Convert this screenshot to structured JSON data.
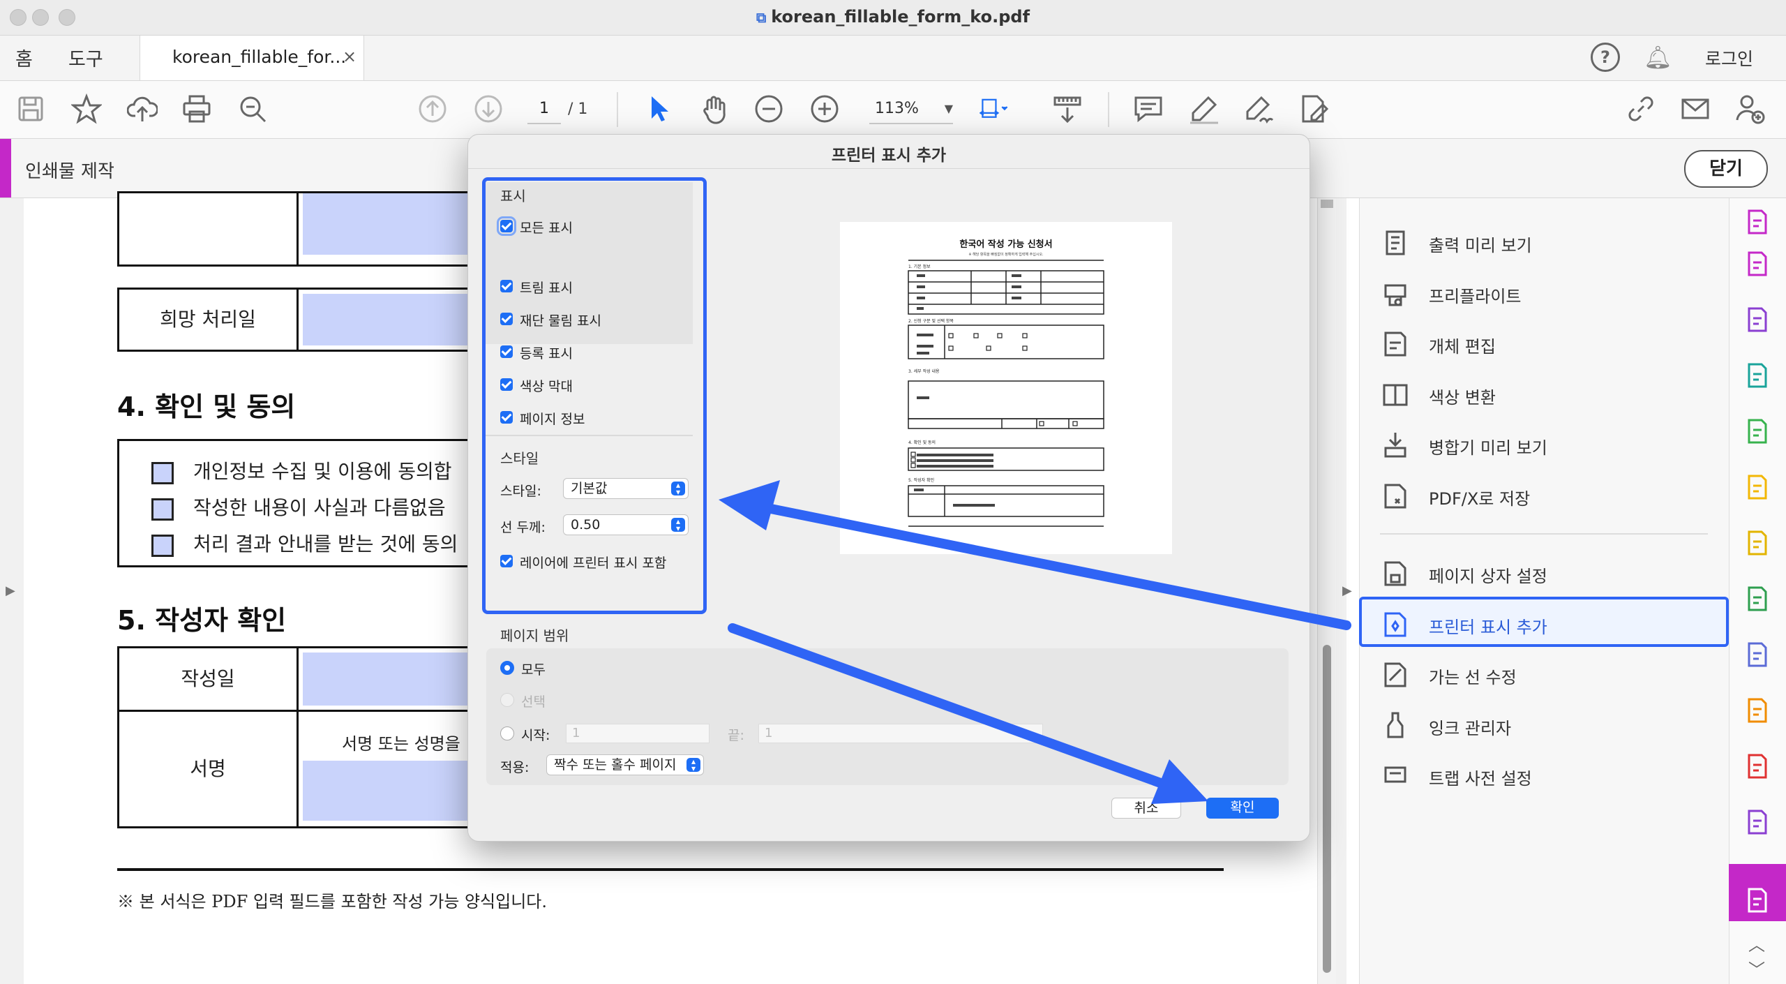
{
  "window": {
    "title": "korean_fillable_form_ko.pdf"
  },
  "tabs": {
    "home": "홈",
    "tools": "도구",
    "document": "korean_fillable_for...",
    "close": "×",
    "login": "로그인"
  },
  "toolbar": {
    "page_current": "1",
    "page_total": "/ 1",
    "zoom": "113%"
  },
  "tool_header": {
    "title": "인쇄물 제작",
    "close": "닫기"
  },
  "document": {
    "row_desired_date": "희망 처리일",
    "section4_title": "4. 확인 및 동의",
    "consent_items": [
      "개인정보 수집 및 이용에 동의합",
      "작성한 내용이 사실과 다름없음",
      "처리 결과 안내를 받는 것에 동의"
    ],
    "section5_title": "5. 작성자 확인",
    "row_date": "작성일",
    "row_signature": "서명",
    "signature_hint": "서명 또는 성명을",
    "footer_note": "※ 본 서식은 PDF 입력 필드를 포함한 작성 가능 양식입니다."
  },
  "dialog": {
    "title": "프린터 표시 추가",
    "marks_section": "표시",
    "all_marks": "모든 표시",
    "marks": [
      "트림 표시",
      "재단 물림 표시",
      "등록 표시",
      "색상 막대",
      "페이지 정보"
    ],
    "style_section": "스타일",
    "style_label": "스타일:",
    "style_value": "기본값",
    "line_label": "선 두께:",
    "line_value": "0.50",
    "include_layer": "레이어에 프린터 표시 포함",
    "range_section": "페이지 범위",
    "range_all": "모두",
    "range_selection": "선택",
    "range_from": "시작:",
    "range_from_value": "1",
    "range_to": "끝:",
    "range_to_value": "1",
    "apply_label": "적용:",
    "apply_value": "짝수 또는 홀수 페이지",
    "cancel": "취소",
    "ok": "확인"
  },
  "preview": {
    "title": "한국어 작성 가능 신청서",
    "subtitle": "※ 해당 항목을 빠짐없이 정확하게 입력해 주십시오.",
    "s1": "1. 기본 정보",
    "s2": "2. 신청 구분 및 선택 항목",
    "s3": "3. 세부 작성 내용",
    "s4": "4. 확인 및 동의",
    "s5": "5. 작성자 확인"
  },
  "right_panel": {
    "items": [
      "출력 미리 보기",
      "프리플라이트",
      "개체 편집",
      "색상 변환",
      "병합기 미리 보기",
      "PDF/X로 저장"
    ],
    "items2": [
      "페이지 상자 설정",
      "프린터 표시 추가",
      "가는 선 수정",
      "잉크 관리자",
      "트랩 사전 설정"
    ]
  },
  "colors": {
    "accent": "#2f64f5",
    "tool_accent": "#c428c8",
    "field_fill": "#c9d3fb",
    "checkbox": "#1d6ef5"
  }
}
